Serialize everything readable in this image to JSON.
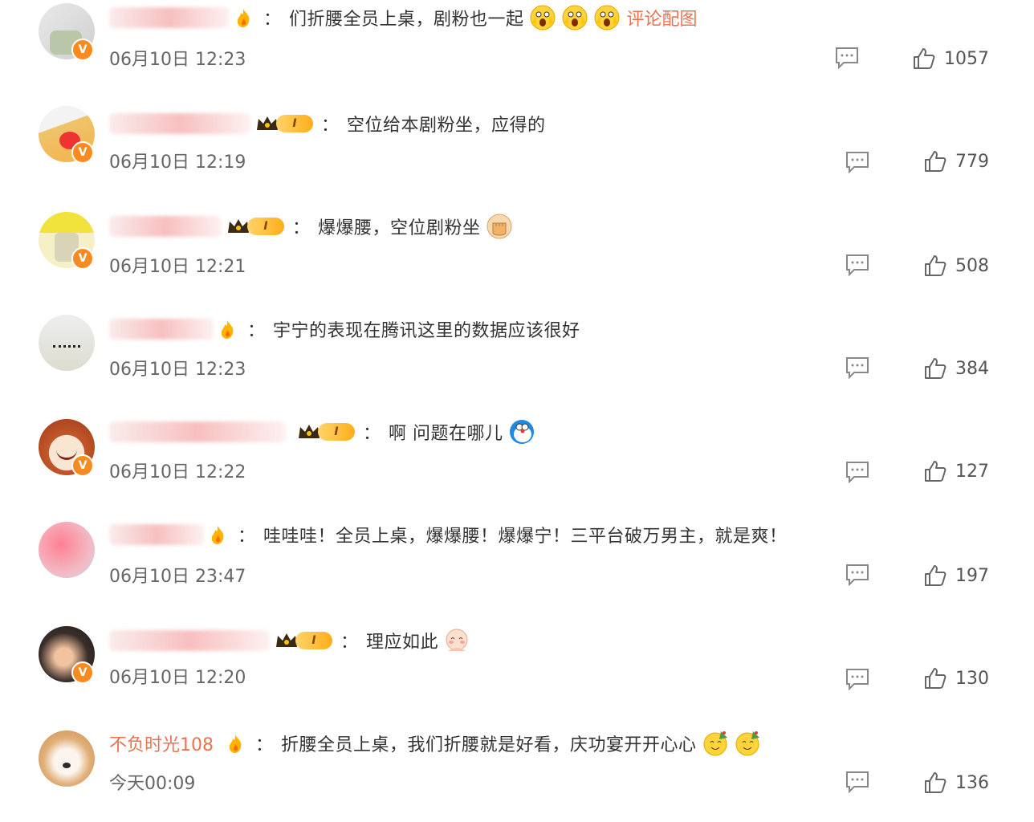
{
  "comments": [
    {
      "name": "",
      "text": "们折腰全员上桌，剧粉也一起",
      "link": "评论配图",
      "time": "06月10日 12:23",
      "likes": "1057"
    },
    {
      "name": "",
      "text": "空位给本剧粉坐，应得的",
      "time": "06月10日 12:19",
      "likes": "779"
    },
    {
      "name": "",
      "text": "爆爆腰，空位剧粉坐",
      "time": "06月10日 12:21",
      "likes": "508"
    },
    {
      "name": "",
      "text": "宇宁的表现在腾讯这里的数据应该很好",
      "time": "06月10日 12:23",
      "likes": "384"
    },
    {
      "name": "",
      "text": "啊 问题在哪儿",
      "time": "06月10日 12:22",
      "likes": "127"
    },
    {
      "name": "",
      "text": "哇哇哇！全员上桌，爆爆腰！爆爆宁！三平台破万男主，就是爽！",
      "time": "06月10日 23:47",
      "likes": "197"
    },
    {
      "name": "",
      "text": "理应如此",
      "time": "06月10日 12:20",
      "likes": "130"
    },
    {
      "name": "不负时光108",
      "text": "折腰全员上桌，我们折腰就是好看，庆功宴开开心心",
      "time": "今天00:09",
      "likes": "136"
    }
  ],
  "separator": "：",
  "badge_letter": "I",
  "verified_letter": "V",
  "colors": {
    "accent": "#eb7350",
    "verified": "#f78b1f",
    "text": "#333333",
    "meta": "#666666"
  },
  "icons": {
    "reply": "comment-bubble-icon",
    "like": "thumbs-up-icon",
    "level": "crown-badge-icon",
    "fan": "flame-icon"
  }
}
